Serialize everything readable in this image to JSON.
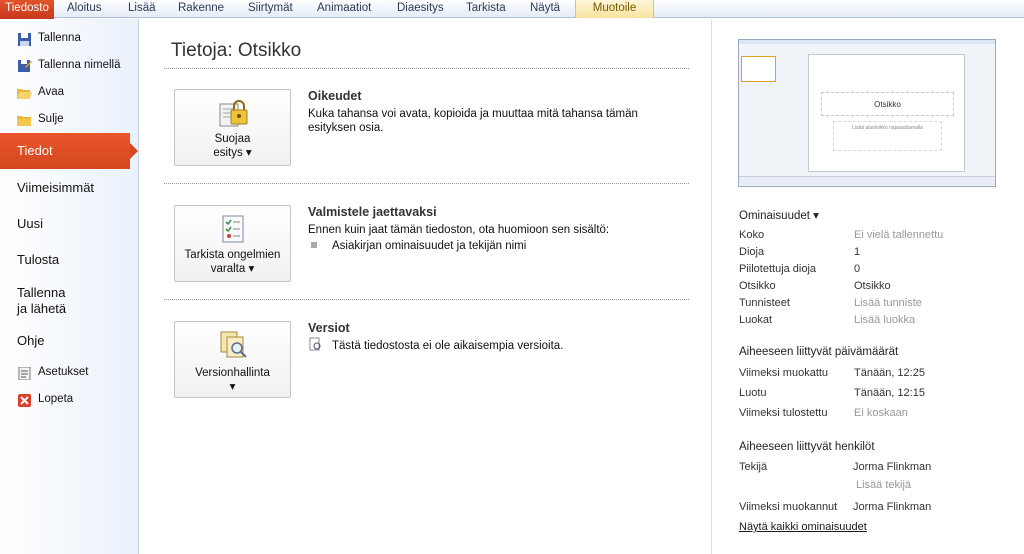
{
  "ribbon": {
    "file_tab": "Tiedosto",
    "tabs": [
      "Aloitus",
      "Lisää",
      "Rakenne",
      "Siirtymät",
      "Animaatiot",
      "Diaesitys",
      "Tarkista",
      "Näytä"
    ],
    "context_tab": "Muotoile"
  },
  "sidebar": {
    "small": [
      {
        "label": "Tallenna",
        "icon": "save-icon"
      },
      {
        "label": "Tallenna nimellä",
        "icon": "save-as-icon"
      },
      {
        "label": "Avaa",
        "icon": "open-folder-icon"
      },
      {
        "label": "Sulje",
        "icon": "close-folder-icon"
      }
    ],
    "active": "Tiedot",
    "big": [
      "Viimeisimmät",
      "Uusi",
      "Tulosta",
      "Tallenna\nja lähetä",
      "Ohje"
    ],
    "bottom": [
      {
        "label": "Asetukset",
        "icon": "options-icon"
      },
      {
        "label": "Lopeta",
        "icon": "exit-icon"
      }
    ]
  },
  "main": {
    "title": "Tietoja: Otsikko",
    "sections": [
      {
        "button": "Suojaa\nesitys ▾",
        "heading": "Oikeudet",
        "text": "Kuka tahansa voi avata, kopioida ja muuttaa mitä tahansa tämän esityksen osia."
      },
      {
        "button": "Tarkista ongelmien\nvaralta ▾",
        "heading": "Valmistele jaettavaksi",
        "text": "Ennen kuin jaat tämän tiedoston, ota huomioon sen sisältö:",
        "bullet": "Asiakirjan ominaisuudet ja tekijän nimi"
      },
      {
        "button": "Versionhallinta\n▾",
        "heading": "Versiot",
        "text": "Tästä tiedostosta ei ole aikaisempia versioita."
      }
    ]
  },
  "preview": {
    "slide_title": "Otsikko",
    "slide_subtitle": "Lisää alaotsikko napsauttamalla"
  },
  "properties": {
    "header": "Ominaisuudet ▾",
    "rows": [
      {
        "label": "Koko",
        "value": "Ei vielä tallennettu",
        "muted": true
      },
      {
        "label": "Dioja",
        "value": "1",
        "muted": false
      },
      {
        "label": "Piilotettuja dioja",
        "value": "0",
        "muted": false
      },
      {
        "label": "Otsikko",
        "value": "Otsikko",
        "muted": false
      },
      {
        "label": "Tunnisteet",
        "value": "Lisää tunniste",
        "muted": true
      },
      {
        "label": "Luokat",
        "value": "Lisää luokka",
        "muted": true
      }
    ],
    "dates_header": "Aiheeseen liittyvät päivämäärät",
    "dates": [
      {
        "label": "Viimeksi muokattu",
        "value": "Tänään, 12:25",
        "muted": false
      },
      {
        "label": "Luotu",
        "value": "Tänään, 12:15",
        "muted": false
      },
      {
        "label": "Viimeksi tulostettu",
        "value": "Ei koskaan",
        "muted": true
      }
    ],
    "people_header": "Aiheeseen liittyvät henkilöt",
    "author_label": "Tekijä",
    "author": "Jorma Flinkman",
    "add_author": "Lisää tekijä",
    "modified_by_label": "Viimeksi muokannut",
    "modified_by": "Jorma Flinkman",
    "show_all": "Näytä kaikki ominaisuudet"
  },
  "colors": {
    "file_tab": "#d4471f",
    "ribbon": "#e4ecf7",
    "accent": "#d4471f"
  }
}
